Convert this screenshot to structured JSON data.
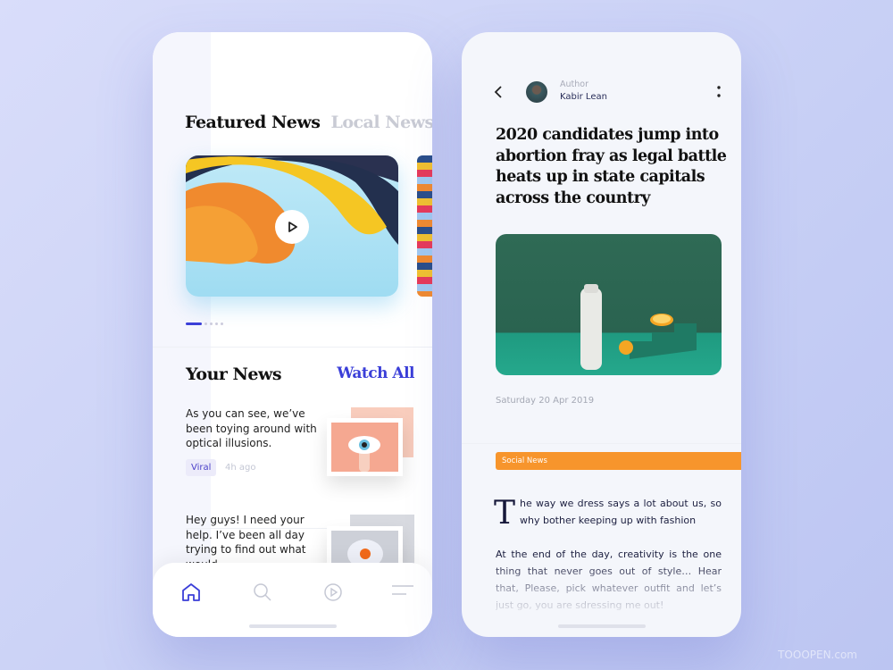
{
  "left": {
    "tabs": [
      "Featured News",
      "Local News"
    ],
    "section_title": "Your News",
    "watch_all": "Watch All",
    "news": [
      {
        "text": "As you can see, we’ve been toying around with optical illusions.",
        "tag": "Viral",
        "time": "4h ago"
      },
      {
        "text": "Hey guys! I need your help. I’ve been all day trying to find out what would."
      }
    ],
    "nav": [
      "home-icon",
      "search-icon",
      "play-icon",
      "menu-icon"
    ],
    "active_nav": "home",
    "carousel_page": 1,
    "carousel_pages": 5
  },
  "right": {
    "author_label": "Author",
    "author_name": "Kabir Lean",
    "title": "2020 candidates jump into abortion fray as legal battle heats up in state capitals across the country",
    "date": "Saturday 20 Apr 2019",
    "category": "Social News",
    "dropcap": "T",
    "para1": "he way we dress says a lot about us, so why bother keeping up with fashion",
    "para2": "At the end of the day, creativity is the one thing that never goes out of style… Hear that, Please, pick whatever outfit and let’s just go, you are sdressing me out!"
  },
  "colors": {
    "accent": "#3b3fd8",
    "orange": "#f7952c",
    "background": "#c7cff5"
  },
  "watermark": "TOOOPEN.com"
}
